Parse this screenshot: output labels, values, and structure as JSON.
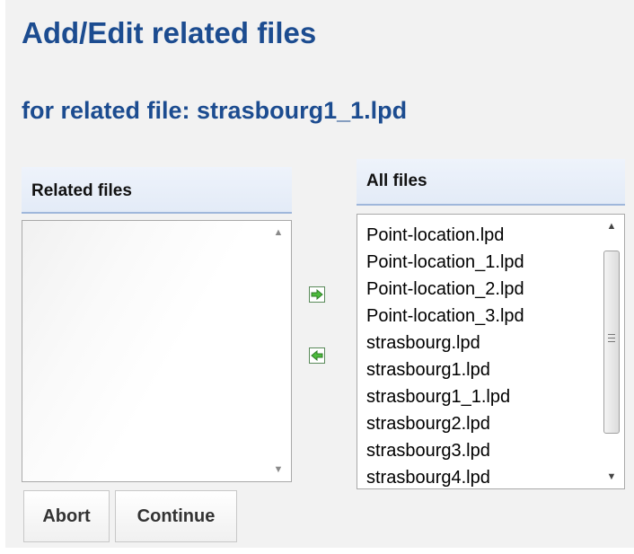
{
  "page": {
    "title": "Add/Edit related files",
    "subtitle": "for related file: strasbourg1_1.lpd"
  },
  "related_files": {
    "header": "Related files",
    "items": []
  },
  "all_files": {
    "header": "All files",
    "items": [
      "Point-location.lpd",
      "Point-location_1.lpd",
      "Point-location_2.lpd",
      "Point-location_3.lpd",
      "strasbourg.lpd",
      "strasbourg1.lpd",
      "strasbourg1_1.lpd",
      "strasbourg2.lpd",
      "strasbourg3.lpd",
      "strasbourg4.lpd"
    ]
  },
  "icons": {
    "add": "arrow-right-icon",
    "remove": "arrow-left-icon",
    "scroll_up": "scroll-up-icon",
    "scroll_down": "scroll-down-icon"
  },
  "colors": {
    "title": "#1c4c90",
    "header_border": "#9fb7db",
    "arrow_green": "#3aa53a"
  },
  "buttons": {
    "abort": "Abort",
    "continue": "Continue"
  }
}
